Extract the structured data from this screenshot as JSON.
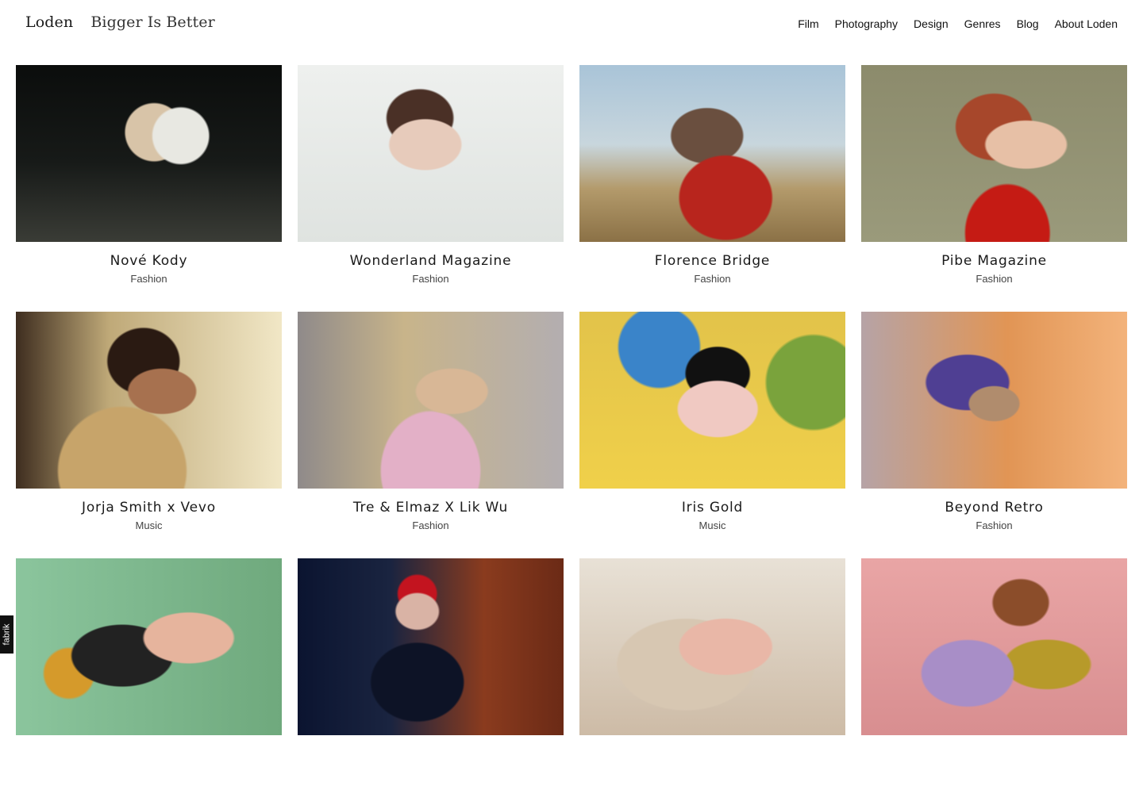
{
  "header": {
    "brand_name": "Loden",
    "tagline": "Bigger Is Better",
    "nav": [
      {
        "label": "Film"
      },
      {
        "label": "Photography"
      },
      {
        "label": "Design"
      },
      {
        "label": "Genres"
      },
      {
        "label": "Blog"
      },
      {
        "label": "About Loden"
      }
    ]
  },
  "projects": [
    {
      "title": "Nové Kody",
      "genre": "Fashion"
    },
    {
      "title": "Wonderland Magazine",
      "genre": "Fashion"
    },
    {
      "title": "Florence Bridge",
      "genre": "Fashion"
    },
    {
      "title": "Pibe Magazine",
      "genre": "Fashion"
    },
    {
      "title": "Jorja Smith x Vevo",
      "genre": "Music"
    },
    {
      "title": "Tre & Elmaz X Lik Wu",
      "genre": "Fashion"
    },
    {
      "title": "Iris Gold",
      "genre": "Music"
    },
    {
      "title": "Beyond Retro",
      "genre": "Fashion"
    },
    {
      "title": "",
      "genre": ""
    },
    {
      "title": "",
      "genre": ""
    },
    {
      "title": "",
      "genre": ""
    },
    {
      "title": "",
      "genre": ""
    }
  ],
  "side_badge": {
    "label": "fabrik"
  }
}
